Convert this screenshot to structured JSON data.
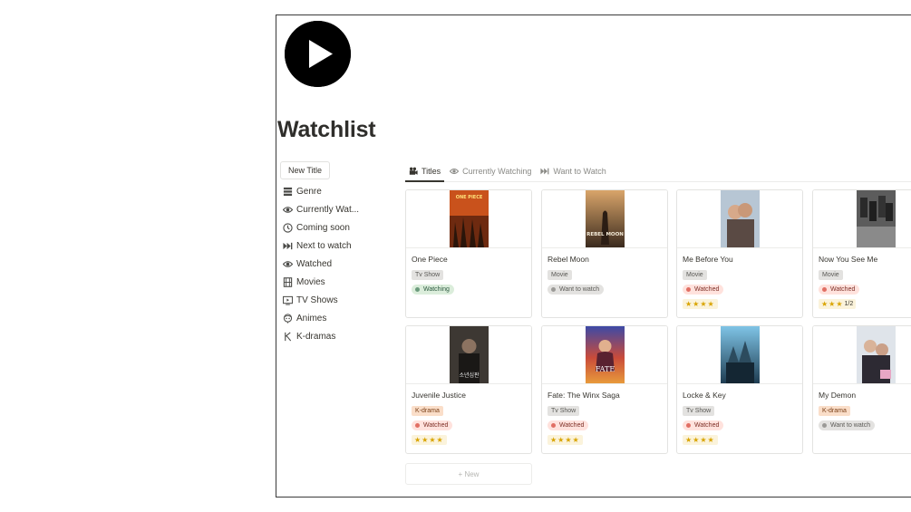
{
  "page": {
    "title": "Watchlist",
    "icon": "play-circle-icon",
    "new_title_label": "New Title",
    "new_label": "+ New"
  },
  "sidebar": {
    "items": [
      {
        "label": "Genre",
        "icon": "stack-icon"
      },
      {
        "label": "Currently Wat...",
        "icon": "eye-icon"
      },
      {
        "label": "Coming soon",
        "icon": "clock-icon"
      },
      {
        "label": "Next to watch",
        "icon": "skip-forward-icon"
      },
      {
        "label": "Watched",
        "icon": "eye-icon"
      },
      {
        "label": "Movies",
        "icon": "film-icon"
      },
      {
        "label": "TV Shows",
        "icon": "tv-icon"
      },
      {
        "label": "Animes",
        "icon": "anime-icon"
      },
      {
        "label": "K-dramas",
        "icon": "k-letter-icon"
      }
    ]
  },
  "tabs": [
    {
      "label": "Titles",
      "icon": "camera-icon",
      "active": true
    },
    {
      "label": "Currently Watching",
      "icon": "eye-icon",
      "active": false
    },
    {
      "label": "Want to Watch",
      "icon": "skip-forward-icon",
      "active": false
    }
  ],
  "cards": [
    {
      "title": "One Piece",
      "type": "Tv Show",
      "status": "Watching",
      "rating": "★★★★",
      "rating_fraction": ""
    },
    {
      "title": "Rebel Moon",
      "type": "Movie",
      "status": "Want to watch",
      "rating": "",
      "rating_fraction": ""
    },
    {
      "title": "Me Before You",
      "type": "Movie",
      "status": "Watched",
      "rating": "★★★★",
      "rating_fraction": ""
    },
    {
      "title": "Now You See Me",
      "type": "Movie",
      "status": "Watched",
      "rating": "★★★",
      "rating_fraction": "1/2"
    },
    {
      "title": "Juvenile Justice",
      "type": "K-drama",
      "status": "Watched",
      "rating": "★★★★",
      "rating_fraction": ""
    },
    {
      "title": "Fate: The Winx Saga",
      "type": "Tv Show",
      "status": "Watched",
      "rating": "★★★★",
      "rating_fraction": ""
    },
    {
      "title": "Locke & Key",
      "type": "Tv Show",
      "status": "Watched",
      "rating": "★★★★",
      "rating_fraction": ""
    },
    {
      "title": "My Demon",
      "type": "K-drama",
      "status": "Want to watch",
      "rating": "",
      "rating_fraction": ""
    }
  ],
  "poster_text": {
    "one_piece": "ONE PIECE",
    "rebel_moon": "REBEL MOON",
    "juvenile_justice": "소년심판",
    "fate": "FATE"
  },
  "colors": {
    "tv_show_tag": "#e3e2e0",
    "movie_tag": "#e3e2e0",
    "kdrama_tag": "#fadec9",
    "watching_bg": "#dbeddb",
    "watching_dot": "#6c9b7d",
    "watched_bg": "#ffe2dd",
    "watched_dot": "#e16f64",
    "want_bg": "#e3e2e0",
    "want_dot": "#9b9a97",
    "star": "#f2c230"
  }
}
